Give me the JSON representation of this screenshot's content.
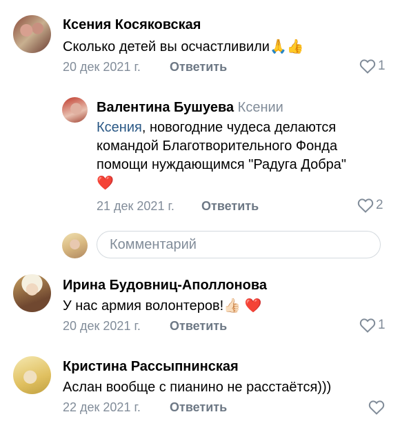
{
  "comments": [
    {
      "author": "Ксения Косяковская",
      "text": "Сколько детей вы осчастливили",
      "emoji": "🙏👍",
      "date": "20 дек 2021 г.",
      "reply_label": "Ответить",
      "likes": "1"
    },
    {
      "author": "Валентина Бушуева",
      "reply_to": "Ксении",
      "mention": "Ксения",
      "text_line1_rest": ", новогодние чудеса делаются",
      "text_line2": "командой Благотворительного Фонда",
      "text_line3": "помощи нуждающимся \"Радуга Добра\"",
      "emoji": "❤️",
      "date": "21 дек 2021 г.",
      "reply_label": "Ответить",
      "likes": "2"
    },
    {
      "author": "Ирина Будовниц-Аполлонова",
      "text": "У нас армия волонтеров!",
      "emoji": "👍🏻 ❤️",
      "date": "20 дек 2021 г.",
      "reply_label": "Ответить",
      "likes": "1"
    },
    {
      "author": "Кристина Рассыпнинская",
      "text": "Аслан вообще с пианино не расстаётся)))",
      "date": "22 дек 2021 г.",
      "reply_label": "Ответить",
      "likes": ""
    }
  ],
  "comment_input": {
    "placeholder": "Комментарий"
  },
  "icons": {
    "like": "heart-outline-icon"
  },
  "colors": {
    "link": "#2a5885",
    "secondary": "#818c99"
  }
}
